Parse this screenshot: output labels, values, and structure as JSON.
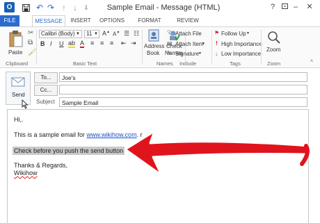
{
  "window": {
    "title": "Sample Email - Message (HTML)"
  },
  "quick_access": {
    "save_icon": "save-icon",
    "undo_icon": "undo-icon",
    "redo_icon": "redo-icon",
    "up_icon": "up-arrow-icon",
    "down_icon": "down-arrow-icon",
    "customize_icon": "customize-icon"
  },
  "window_controls": {
    "help": "?",
    "minimize": "–",
    "close": "✕"
  },
  "tabs": {
    "file": "FILE",
    "message": "MESSAGE",
    "insert": "INSERT",
    "options": "OPTIONS",
    "format_text": "FORMAT TEXT",
    "review": "REVIEW"
  },
  "ribbon": {
    "clipboard": {
      "label": "Clipboard",
      "paste": "Paste"
    },
    "basic_text": {
      "label": "Basic Text",
      "font": "Calibri (Body)",
      "size": "11",
      "bold": "B",
      "italic": "I",
      "underline": "U"
    },
    "names": {
      "label": "Names",
      "address_book_1": "Address",
      "address_book_2": "Book",
      "check_names_1": "Check",
      "check_names_2": "Names"
    },
    "include": {
      "label": "Include",
      "attach_file": "Attach File",
      "attach_item": "Attach Item",
      "signature": "Signature"
    },
    "tags": {
      "label": "Tags",
      "follow_up": "Follow Up",
      "high_importance": "High Importance",
      "low_importance": "Low Importance"
    },
    "zoom": {
      "label": "Zoom",
      "zoom_btn": "Zoom"
    }
  },
  "compose": {
    "send": "Send",
    "to_button": "To...",
    "to_value": "Joe's",
    "cc_button": "Cc...",
    "cc_value": "",
    "subject_label": "Subject",
    "subject_value": "Sample Email"
  },
  "body": {
    "greeting": "Hi,.",
    "line1_text": "This is a sample email for ",
    "line1_link": "www.wikihow.com",
    "line1_tail": ". r",
    "highlight": "Check before you push the send button",
    "closing": "Thanks & Regards,",
    "signature": "Wikihow"
  },
  "colors": {
    "accent": "#2b6bcf",
    "arrow": "#e0141c",
    "highlight": "#c9c9c9",
    "link": "#1f4fc2"
  }
}
